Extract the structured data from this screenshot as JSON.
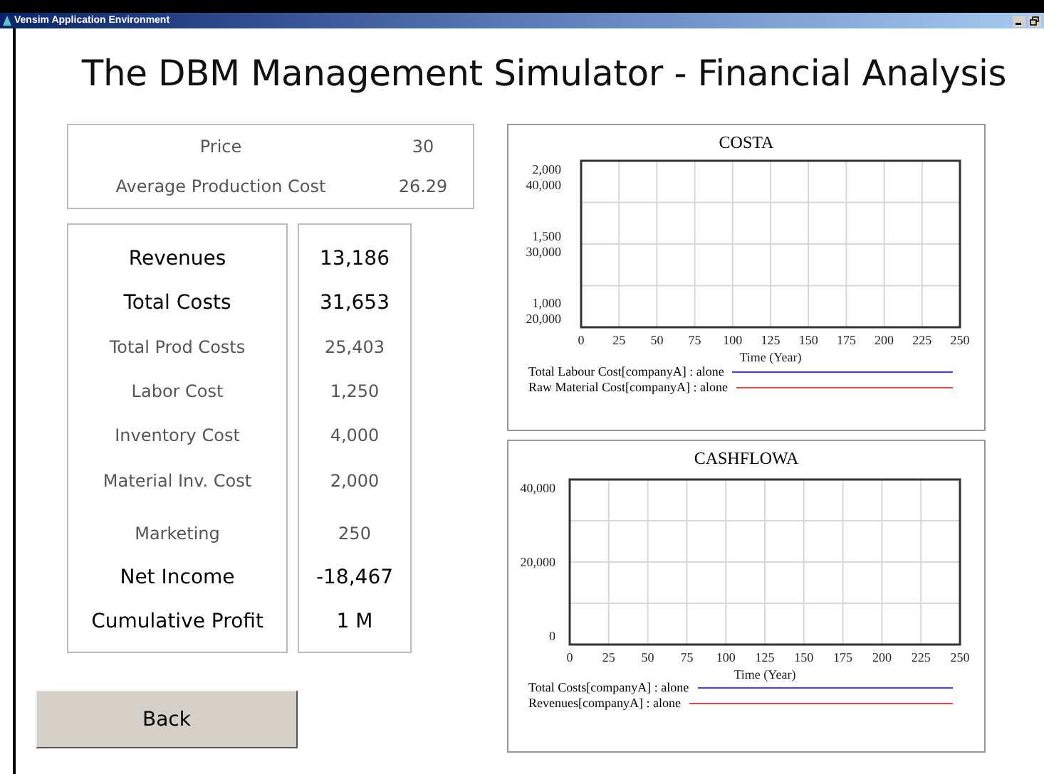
{
  "window": {
    "title": "Vensim Application Environment"
  },
  "heading": "The DBM Management Simulator - Financial Analysis",
  "inputs": [
    {
      "label": "Price",
      "value": "30"
    },
    {
      "label": "Average Production Cost",
      "value": "26.29"
    }
  ],
  "results": [
    {
      "label": "Revenues",
      "value": "13,186",
      "kind": "bold"
    },
    {
      "label": "Total Costs",
      "value": "31,653",
      "kind": "bold"
    },
    {
      "label": "Total Prod Costs",
      "value": "25,403",
      "kind": "normal"
    },
    {
      "label": "Labor Cost",
      "value": "1,250",
      "kind": "normal"
    },
    {
      "label": "Inventory Cost",
      "value": "4,000",
      "kind": "normal"
    },
    {
      "label": "Material Inv. Cost",
      "value": "2,000",
      "kind": "normal"
    },
    {
      "label": "Marketing",
      "value": "250",
      "kind": "normal"
    },
    {
      "label": "Net Income",
      "value": "-18,467",
      "kind": "bold"
    },
    {
      "label": "Cumulative Profit",
      "value": "1 M",
      "kind": "bold"
    }
  ],
  "back_button": "Back",
  "charts": [
    {
      "title": "COSTA",
      "x_axis_title": "Time (Year)",
      "x_labels": [
        "0",
        "25",
        "50",
        "75",
        "100",
        "125",
        "150",
        "175",
        "200",
        "225",
        "250"
      ],
      "y_labels": [
        [
          "2,000",
          "40,000"
        ],
        [
          "1,500",
          "30,000"
        ],
        [
          "1,000",
          "20,000"
        ]
      ],
      "legend": [
        {
          "label": "Total Labour Cost[companyA] : alone",
          "color": "#4040f0"
        },
        {
          "label": "Raw Material Cost[companyA] : alone",
          "color": "#f04040"
        }
      ]
    },
    {
      "title": "CASHFLOWA",
      "x_axis_title": "Time (Year)",
      "x_labels": [
        "0",
        "25",
        "50",
        "75",
        "100",
        "125",
        "150",
        "175",
        "200",
        "225",
        "250"
      ],
      "y_labels": [
        [
          "40,000"
        ],
        [
          "20,000"
        ],
        [
          "0"
        ]
      ],
      "legend": [
        {
          "label": "Total Costs[companyA] : alone",
          "color": "#4040f0"
        },
        {
          "label": "Revenues[companyA] : alone",
          "color": "#f04040"
        }
      ]
    }
  ]
}
